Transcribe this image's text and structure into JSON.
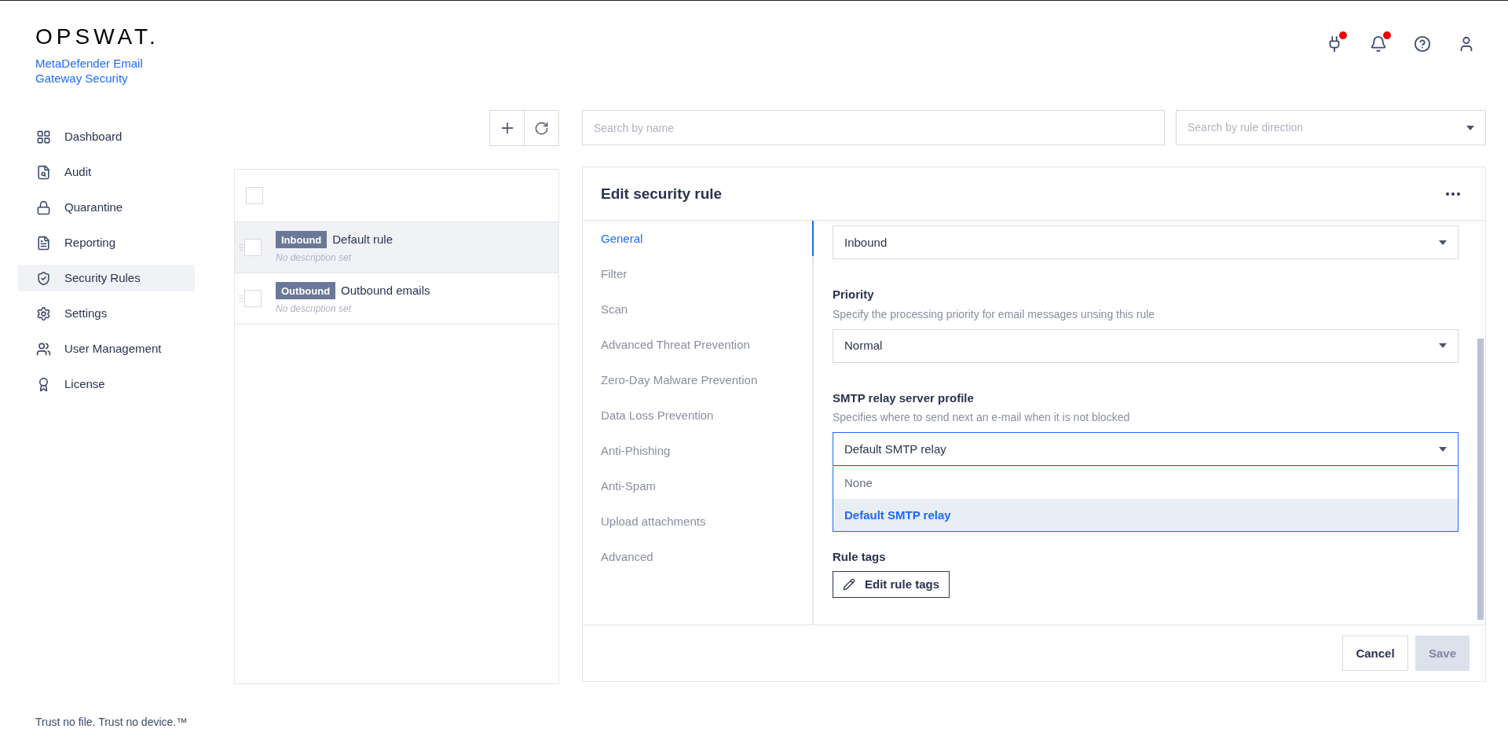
{
  "brand": {
    "logo": "OPSWAT.",
    "product": "MetaDefender Email Gateway Security"
  },
  "header_icons": [
    {
      "kind": "plug",
      "badge": true
    },
    {
      "kind": "bell",
      "badge": true
    },
    {
      "kind": "help"
    },
    {
      "kind": "user"
    }
  ],
  "sidebar": {
    "items": [
      {
        "label": "Dashboard",
        "kind": "grid",
        "selected": false
      },
      {
        "label": "Audit",
        "kind": "audit",
        "selected": false
      },
      {
        "label": "Quarantine",
        "kind": "lock",
        "selected": false
      },
      {
        "label": "Reporting",
        "kind": "doc",
        "selected": false
      },
      {
        "label": "Security Rules",
        "kind": "shield",
        "selected": true
      },
      {
        "label": "Settings",
        "kind": "gear",
        "selected": false
      },
      {
        "label": "User Management",
        "kind": "users",
        "selected": false
      },
      {
        "label": "License",
        "kind": "award",
        "selected": false
      }
    ]
  },
  "search": {
    "placeholder": "Search by name"
  },
  "direction_filter": {
    "placeholder": "Search by rule direction"
  },
  "rules_list": {
    "select_all": {
      "checked": false
    },
    "rows": [
      {
        "direction": "Inbound",
        "name": "Default rule",
        "description": "No description set",
        "selected": true,
        "checked": false
      },
      {
        "direction": "Outbound",
        "name": "Outbound emails",
        "description": "No description set",
        "selected": false,
        "checked": false
      }
    ]
  },
  "editor": {
    "title": "Edit security rule",
    "nav": [
      {
        "label": "General",
        "selected": true
      },
      {
        "label": "Filter",
        "selected": false
      },
      {
        "label": "Scan",
        "selected": false
      },
      {
        "label": "Advanced Threat Prevention",
        "selected": false
      },
      {
        "label": "Zero-Day Malware Prevention",
        "selected": false
      },
      {
        "label": "Data Loss Prevention",
        "selected": false
      },
      {
        "label": "Anti-Phishing",
        "selected": false
      },
      {
        "label": "Anti-Spam",
        "selected": false
      },
      {
        "label": "Upload attachments",
        "selected": false
      },
      {
        "label": "Advanced",
        "selected": false
      }
    ],
    "fields": [
      {
        "kind": "select",
        "value": "Inbound",
        "expanded": false
      },
      {
        "kind": "select",
        "label": "Priority",
        "hint": "Specify the processing priority for email messages unsing this rule",
        "value": "Normal",
        "expanded": false
      },
      {
        "kind": "select",
        "label": "SMTP relay server profile",
        "hint": "Specifies where to send next an e-mail when it is not blocked",
        "value": "Default SMTP relay",
        "expanded": true,
        "options": [
          {
            "label": "None",
            "selected": false
          },
          {
            "label": "Default SMTP relay",
            "selected": true
          }
        ]
      },
      {
        "kind": "covered"
      },
      {
        "kind": "tags",
        "label": "Rule tags",
        "button": "Edit rule tags"
      }
    ],
    "buttons": [
      {
        "label": "Cancel",
        "kind": "secondary",
        "disabled": false
      },
      {
        "label": "Save",
        "kind": "primary",
        "disabled": true
      }
    ]
  },
  "footer_text": "Trust no file. Trust no device.™"
}
